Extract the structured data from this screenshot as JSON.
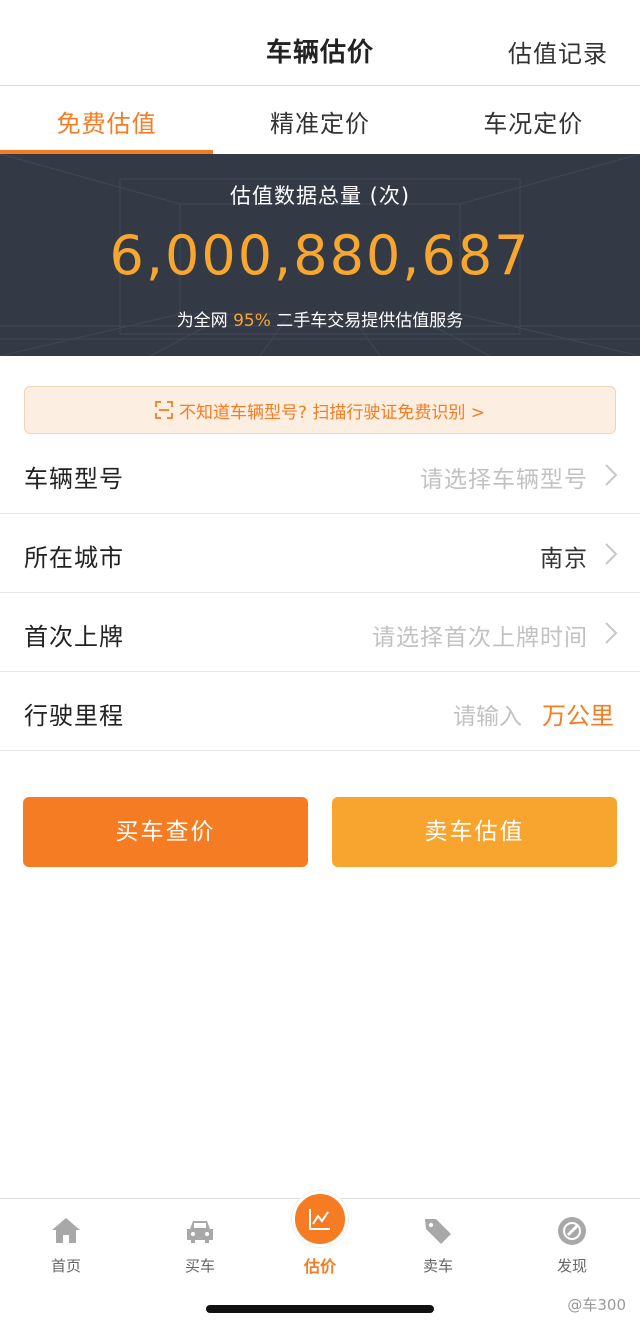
{
  "header": {
    "title": "车辆估价",
    "record_link": "估值记录"
  },
  "tabs": [
    {
      "label": "免费估值",
      "active": true
    },
    {
      "label": "精准定价",
      "active": false
    },
    {
      "label": "车况定价",
      "active": false
    }
  ],
  "banner": {
    "label": "估值数据总量 (次)",
    "count": "6,000,880,687",
    "desc_prefix": "为全网",
    "desc_highlight": "95%",
    "desc_suffix": "二手车交易提供估值服务"
  },
  "scan_tip": {
    "icon": "scan-icon",
    "text": "不知道车辆型号? 扫描行驶证免费识别 >"
  },
  "form": {
    "model": {
      "label": "车辆型号",
      "placeholder": "请选择车辆型号"
    },
    "city": {
      "label": "所在城市",
      "value": "南京"
    },
    "first_plate": {
      "label": "首次上牌",
      "placeholder": "请选择首次上牌时间"
    },
    "mileage": {
      "label": "行驶里程",
      "placeholder": "请输入",
      "unit": "万公里"
    }
  },
  "buttons": {
    "buy_label": "买车查价",
    "sell_label": "卖车估值"
  },
  "nav": [
    {
      "label": "首页",
      "icon": "home-icon"
    },
    {
      "label": "买车",
      "icon": "car-icon"
    },
    {
      "label": "估价",
      "icon": "chart-icon",
      "active": true
    },
    {
      "label": "卖车",
      "icon": "tag-icon"
    },
    {
      "label": "发现",
      "icon": "compass-icon"
    }
  ],
  "watermark": "@车300",
  "colors": {
    "accent": "#f57c22",
    "accent_light": "#f7a52f",
    "banner_bg": "#343946"
  }
}
